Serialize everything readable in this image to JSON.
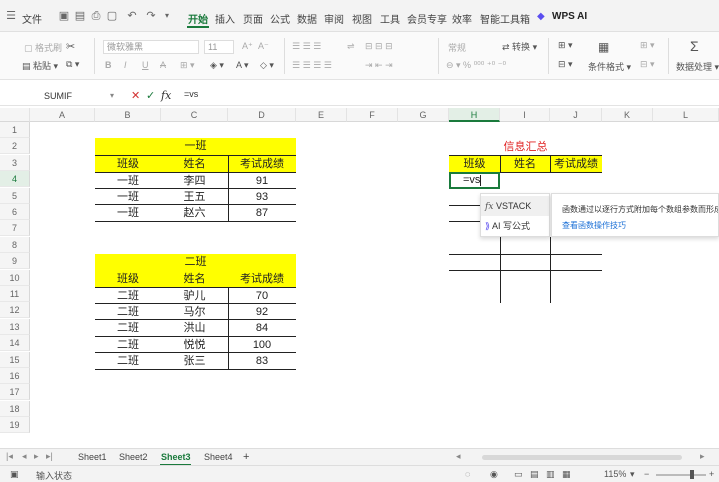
{
  "menubar": {
    "file": "文件",
    "tabs": [
      "开始",
      "插入",
      "页面",
      "公式",
      "数据",
      "审阅",
      "视图",
      "工具",
      "会员专享",
      "效率",
      "智能工具箱"
    ],
    "ai": "WPS AI"
  },
  "ribbon": {
    "format_painter": "格式刷",
    "paste": "粘贴",
    "font_name": "微软雅黑",
    "font_size": "11",
    "number_format": "常规",
    "convert": "转换",
    "conditional_format": "条件格式",
    "data_process": "数据处理"
  },
  "formula_bar": {
    "name_box": "SUMIF",
    "fx": "fx",
    "formula": "=vs"
  },
  "columns": [
    "A",
    "B",
    "C",
    "D",
    "E",
    "F",
    "G",
    "H",
    "I",
    "J",
    "K",
    "L"
  ],
  "rows": [
    "1",
    "2",
    "3",
    "4",
    "5",
    "6",
    "7",
    "8",
    "9",
    "10",
    "11",
    "12",
    "13",
    "14",
    "15",
    "16",
    "17",
    "18",
    "19"
  ],
  "table1": {
    "title": "一班",
    "headers": [
      "班级",
      "姓名",
      "考试成绩"
    ],
    "rows": [
      [
        "一班",
        "李四",
        "91"
      ],
      [
        "一班",
        "王五",
        "93"
      ],
      [
        "一班",
        "赵六",
        "87"
      ]
    ]
  },
  "table2": {
    "title": "二班",
    "headers": [
      "班级",
      "姓名",
      "考试成绩"
    ],
    "rows": [
      [
        "二班",
        "驴儿",
        "70"
      ],
      [
        "二班",
        "马尔",
        "92"
      ],
      [
        "二班",
        "洪山",
        "84"
      ],
      [
        "二班",
        "悦悦",
        "100"
      ],
      [
        "二班",
        "张三",
        "83"
      ]
    ]
  },
  "summary": {
    "title": "信息汇总",
    "headers": [
      "班级",
      "姓名",
      "考试成绩"
    ],
    "editing_value": "=vs"
  },
  "autocomplete": {
    "items": [
      "VSTACK",
      "AI 写公式"
    ],
    "description": "函数通过以逐行方式附加每个数组参数而形成",
    "link": "查看函数操作技巧"
  },
  "sheets": [
    "Sheet1",
    "Sheet2",
    "Sheet3",
    "Sheet4"
  ],
  "active_sheet": "Sheet3",
  "add_sheet": "+",
  "status": {
    "mode": "输入状态",
    "zoom": "115%"
  },
  "colors": {
    "accent": "#1a7a3c",
    "highlight": "#ffff00",
    "summary_title": "#e02020"
  }
}
